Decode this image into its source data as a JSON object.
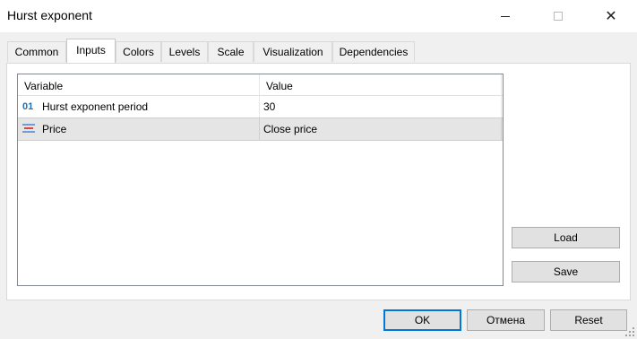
{
  "window": {
    "title": "Hurst exponent",
    "controls": {
      "minimize": "",
      "maximize": "",
      "close": "✕"
    }
  },
  "tabs": [
    {
      "label": "Common",
      "active": false
    },
    {
      "label": "Inputs",
      "active": true
    },
    {
      "label": "Colors",
      "active": false
    },
    {
      "label": "Levels",
      "active": false
    },
    {
      "label": "Scale",
      "active": false
    },
    {
      "label": "Visualization",
      "active": false
    },
    {
      "label": "Dependencies",
      "active": false
    }
  ],
  "grid": {
    "columns": [
      "Variable",
      "Value"
    ],
    "rows": [
      {
        "icon": "int-type-icon",
        "icon_text": "01",
        "variable": "Hurst exponent period",
        "value": "30"
      },
      {
        "icon": "price-type-icon",
        "variable": "Price",
        "value": "Close price",
        "selected": true
      }
    ]
  },
  "side_buttons": {
    "load": "Load",
    "save": "Save"
  },
  "footer_buttons": {
    "ok": "OK",
    "cancel": "Отмена",
    "reset": "Reset"
  },
  "colors": {
    "accent": "#0078d7",
    "selected_row": "#e5e5e5",
    "int_icon": "#1f6fb2"
  }
}
